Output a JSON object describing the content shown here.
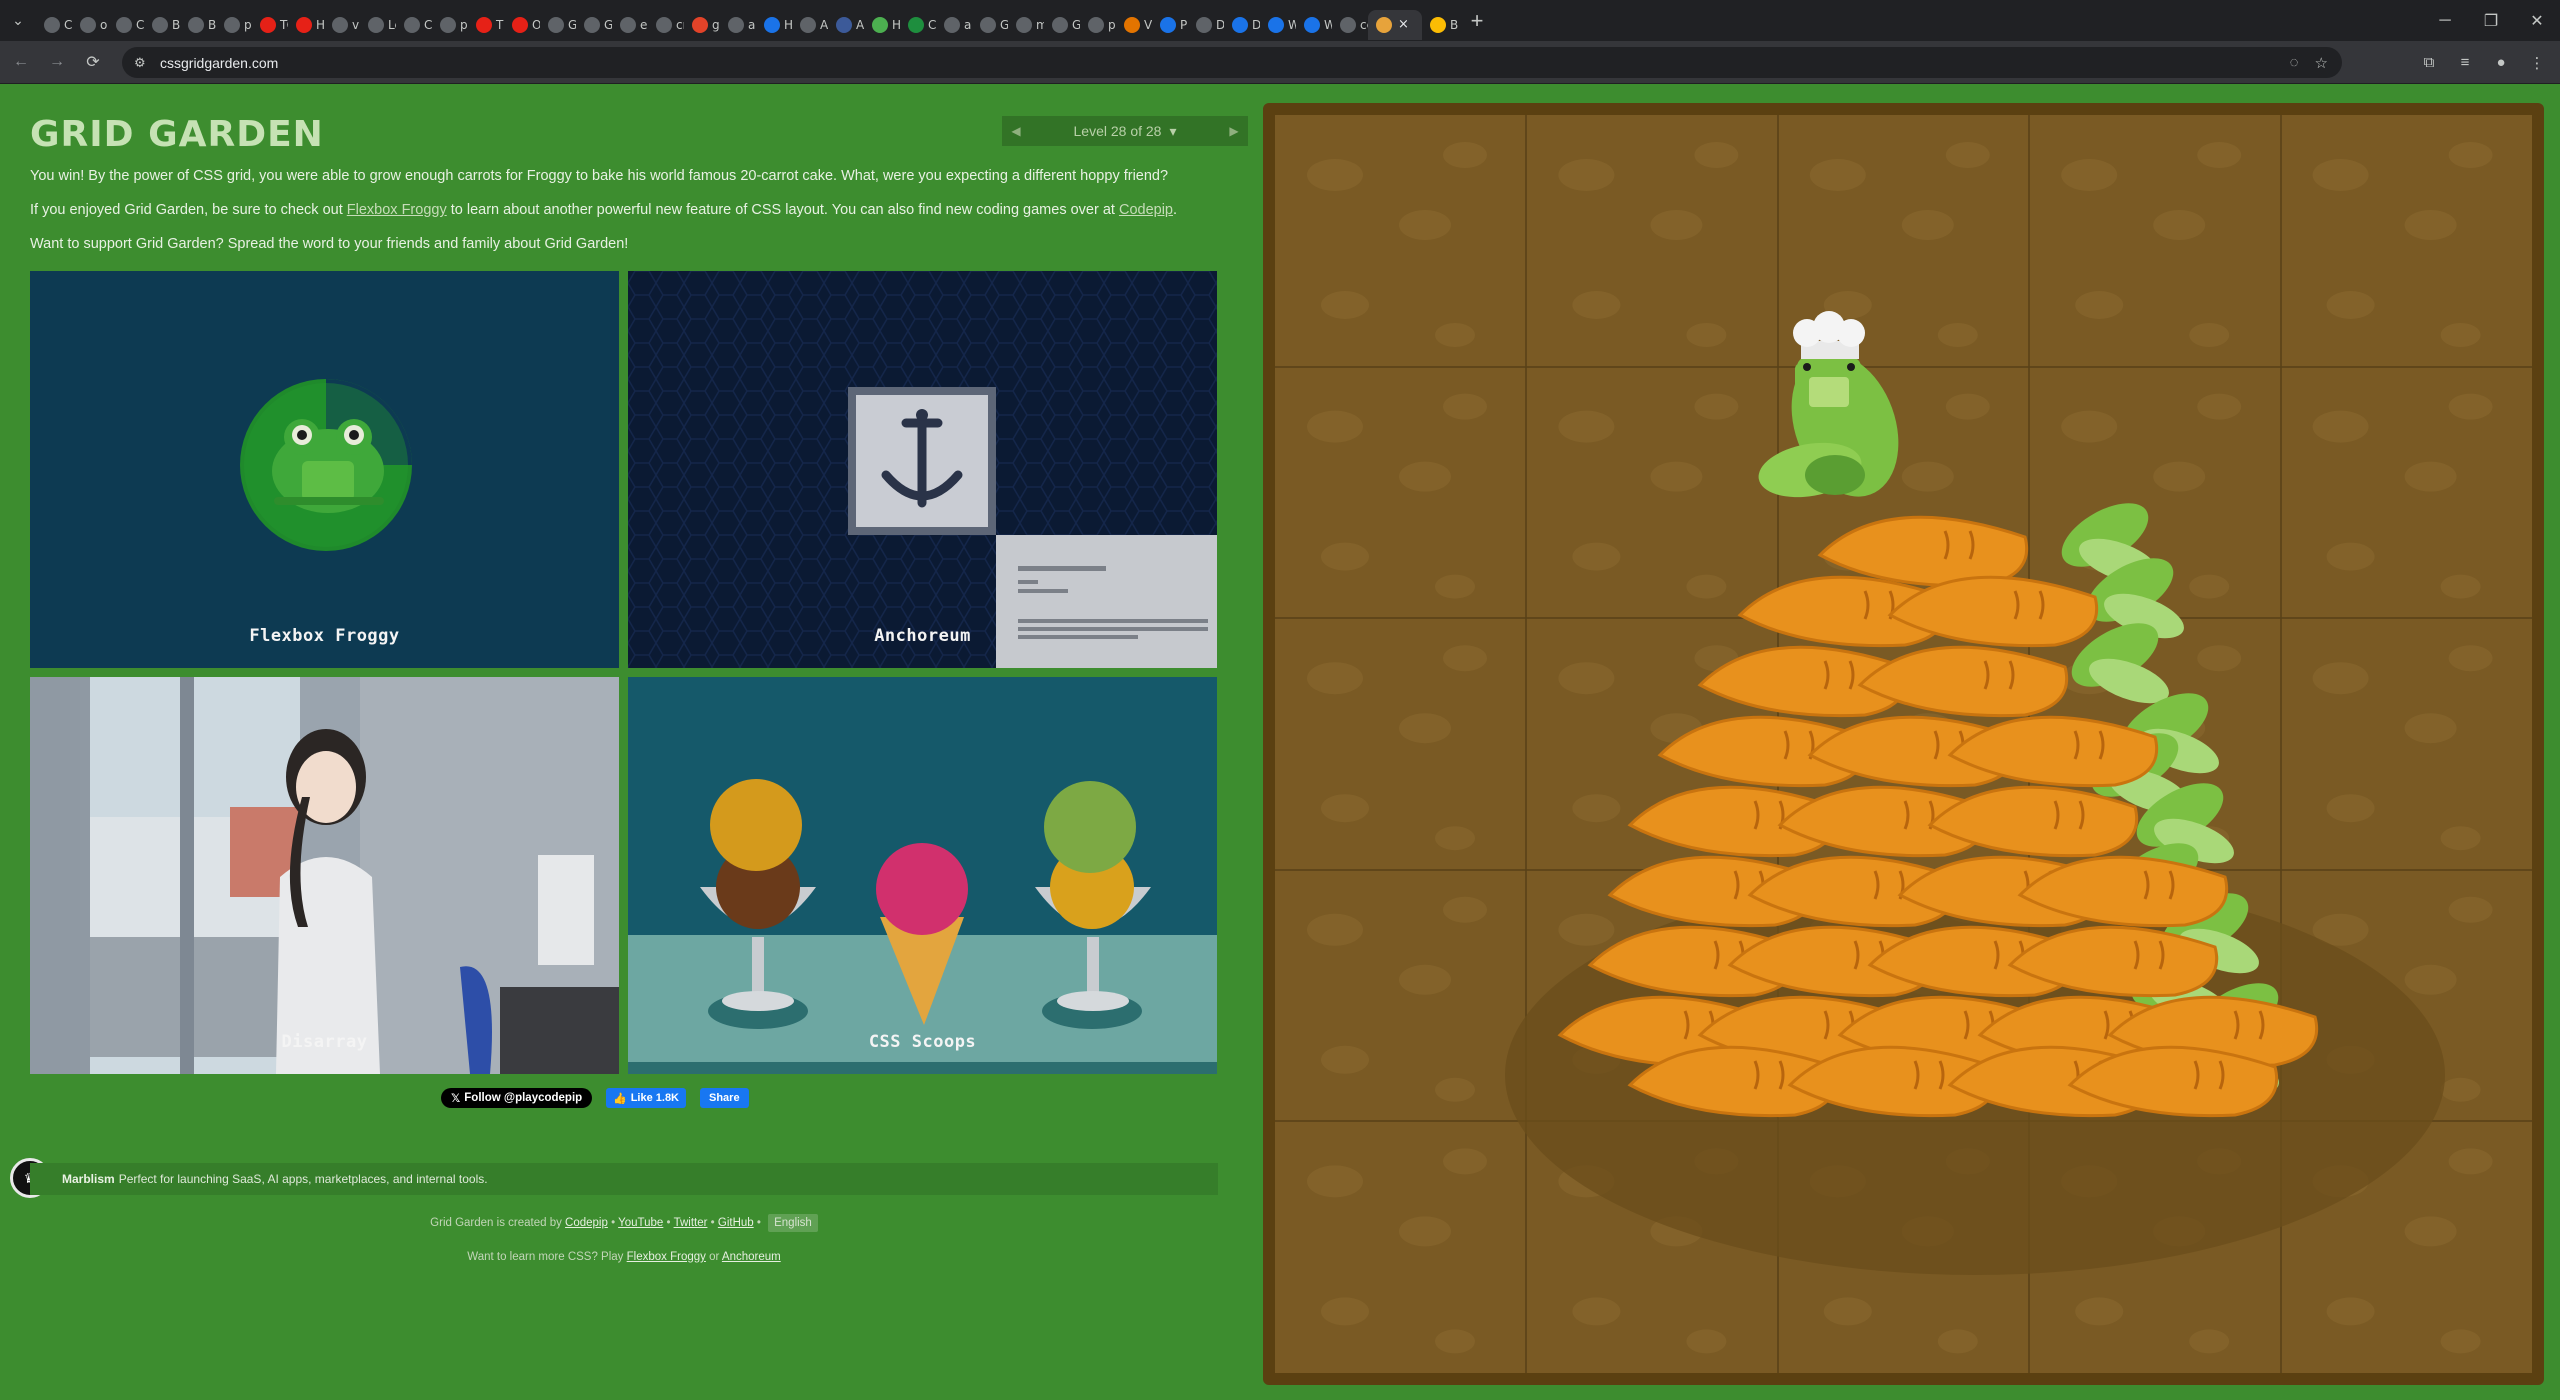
{
  "browser": {
    "tabs": [
      {
        "label": "C",
        "icon": "chrome-icon",
        "color": "#5f6368"
      },
      {
        "label": "or",
        "icon": "google-icon",
        "color": "#5f6368"
      },
      {
        "label": "Cl",
        "icon": "google-icon",
        "color": "#5f6368"
      },
      {
        "label": "Ba",
        "icon": "google-icon",
        "color": "#5f6368"
      },
      {
        "label": "Ba",
        "icon": "google-icon",
        "color": "#5f6368"
      },
      {
        "label": "pt",
        "icon": "github-icon",
        "color": "#5f6368"
      },
      {
        "label": "TC",
        "icon": "youtube-icon",
        "color": "#e62117"
      },
      {
        "label": "Ha",
        "icon": "youtube-icon",
        "color": "#e62117"
      },
      {
        "label": "vn",
        "icon": "google-icon",
        "color": "#5f6368"
      },
      {
        "label": "Le",
        "icon": "google-icon",
        "color": "#5f6368"
      },
      {
        "label": "C",
        "icon": "google-icon",
        "color": "#5f6368"
      },
      {
        "label": "pc",
        "icon": "google-icon",
        "color": "#5f6368"
      },
      {
        "label": "Th",
        "icon": "youtube-icon",
        "color": "#e62117"
      },
      {
        "label": "O!",
        "icon": "youtube-icon",
        "color": "#e62117"
      },
      {
        "label": "Gc",
        "icon": "s-icon",
        "color": "#5f6368"
      },
      {
        "label": "Gi",
        "icon": "github-icon",
        "color": "#5f6368"
      },
      {
        "label": "er",
        "icon": "github-icon",
        "color": "#5f6368"
      },
      {
        "label": "cn",
        "icon": "google-icon",
        "color": "#5f6368"
      },
      {
        "label": "gi",
        "icon": "gitlab-icon",
        "color": "#e24329"
      },
      {
        "label": "au",
        "icon": "google-icon",
        "color": "#5f6368"
      },
      {
        "label": "H",
        "icon": "b-icon",
        "color": "#1a73e8"
      },
      {
        "label": "Au",
        "icon": "table-icon",
        "color": "#5f6368"
      },
      {
        "label": "Au",
        "icon": "flag-icon",
        "color": "#3c5a99"
      },
      {
        "label": "H",
        "icon": "globe-icon",
        "color": "#4caf50"
      },
      {
        "label": "Cc",
        "icon": "leaf-icon",
        "color": "#1e8e3e"
      },
      {
        "label": "au",
        "icon": "google-icon",
        "color": "#5f6368"
      },
      {
        "label": "Gi",
        "icon": "github-icon",
        "color": "#5f6368"
      },
      {
        "label": "m",
        "icon": "google-icon",
        "color": "#5f6368"
      },
      {
        "label": "Gi",
        "icon": "github-icon",
        "color": "#5f6368"
      },
      {
        "label": "pr",
        "icon": "google-icon",
        "color": "#5f6368"
      },
      {
        "label": "VI",
        "icon": "v-icon",
        "color": "#e37400"
      },
      {
        "label": "PF",
        "icon": "a-icon",
        "color": "#1a73e8"
      },
      {
        "label": "D",
        "icon": "dots-icon",
        "color": "#5f6368"
      },
      {
        "label": "D",
        "icon": "mountain-icon",
        "color": "#1a73e8"
      },
      {
        "label": "W",
        "icon": "mountain-icon",
        "color": "#1a73e8"
      },
      {
        "label": "W",
        "icon": "mountain-icon",
        "color": "#1a73e8"
      },
      {
        "label": "cc",
        "icon": "github-icon",
        "color": "#5f6368"
      }
    ],
    "active_tab": {
      "icon": "grid-garden-icon",
      "close": "×"
    },
    "trailing_tab": {
      "label": "Bc",
      "icon": "shield-icon",
      "color": "#fbbc04"
    },
    "new_tab": "+",
    "url": "cssgridgarden.com",
    "window_controls": {
      "minimize": "─",
      "restore": "❐",
      "close": "✕"
    }
  },
  "page": {
    "title": "GRID GARDEN",
    "level": {
      "prev": "◀",
      "text": "Level 28 of 28",
      "caret": "▾",
      "next": "▶"
    },
    "win_text": "You win! By the power of CSS grid, you were able to grow enough carrots for Froggy to bake his world famous 20-carrot cake. What, were you expecting a different hoppy friend?",
    "enjoy_prefix": "If you enjoyed Grid Garden, be sure to check out ",
    "enjoy_link1": "Flexbox Froggy",
    "enjoy_middle": " to learn about another powerful new feature of CSS layout. You can also find new coding games over at ",
    "enjoy_link2": "Codepip",
    "enjoy_suffix": ".",
    "support_text": "Want to support Grid Garden? Spread the word to your friends and family about Grid Garden!",
    "cards": [
      {
        "label": "Flexbox Froggy"
      },
      {
        "label": "Anchoreum"
      },
      {
        "label": "Disarray"
      },
      {
        "label": "CSS Scoops"
      }
    ],
    "social": {
      "follow": "Follow @playcodepip",
      "like": "Like 1.8K",
      "share": "Share"
    },
    "ad": {
      "brand": "Marblism",
      "text": "Perfect for launching SaaS, AI apps, marketplaces, and internal tools."
    },
    "footer": {
      "created_by": "Grid Garden is created by",
      "codepip": "Codepip",
      "sep": "•",
      "youtube": "YouTube",
      "twitter": "Twitter",
      "github": "GitHub",
      "language": "English",
      "learn_prefix": "Want to learn more CSS? Play",
      "flexbox_froggy": "Flexbox Froggy",
      "or": "or",
      "anchoreum": "Anchoreum"
    }
  },
  "colors": {
    "page_bg": "#3d8d2f",
    "soil": "#7a5a24",
    "carrot": "#e8911d",
    "carrot_top": "#7cc043",
    "frog": "#6fbf3a"
  }
}
